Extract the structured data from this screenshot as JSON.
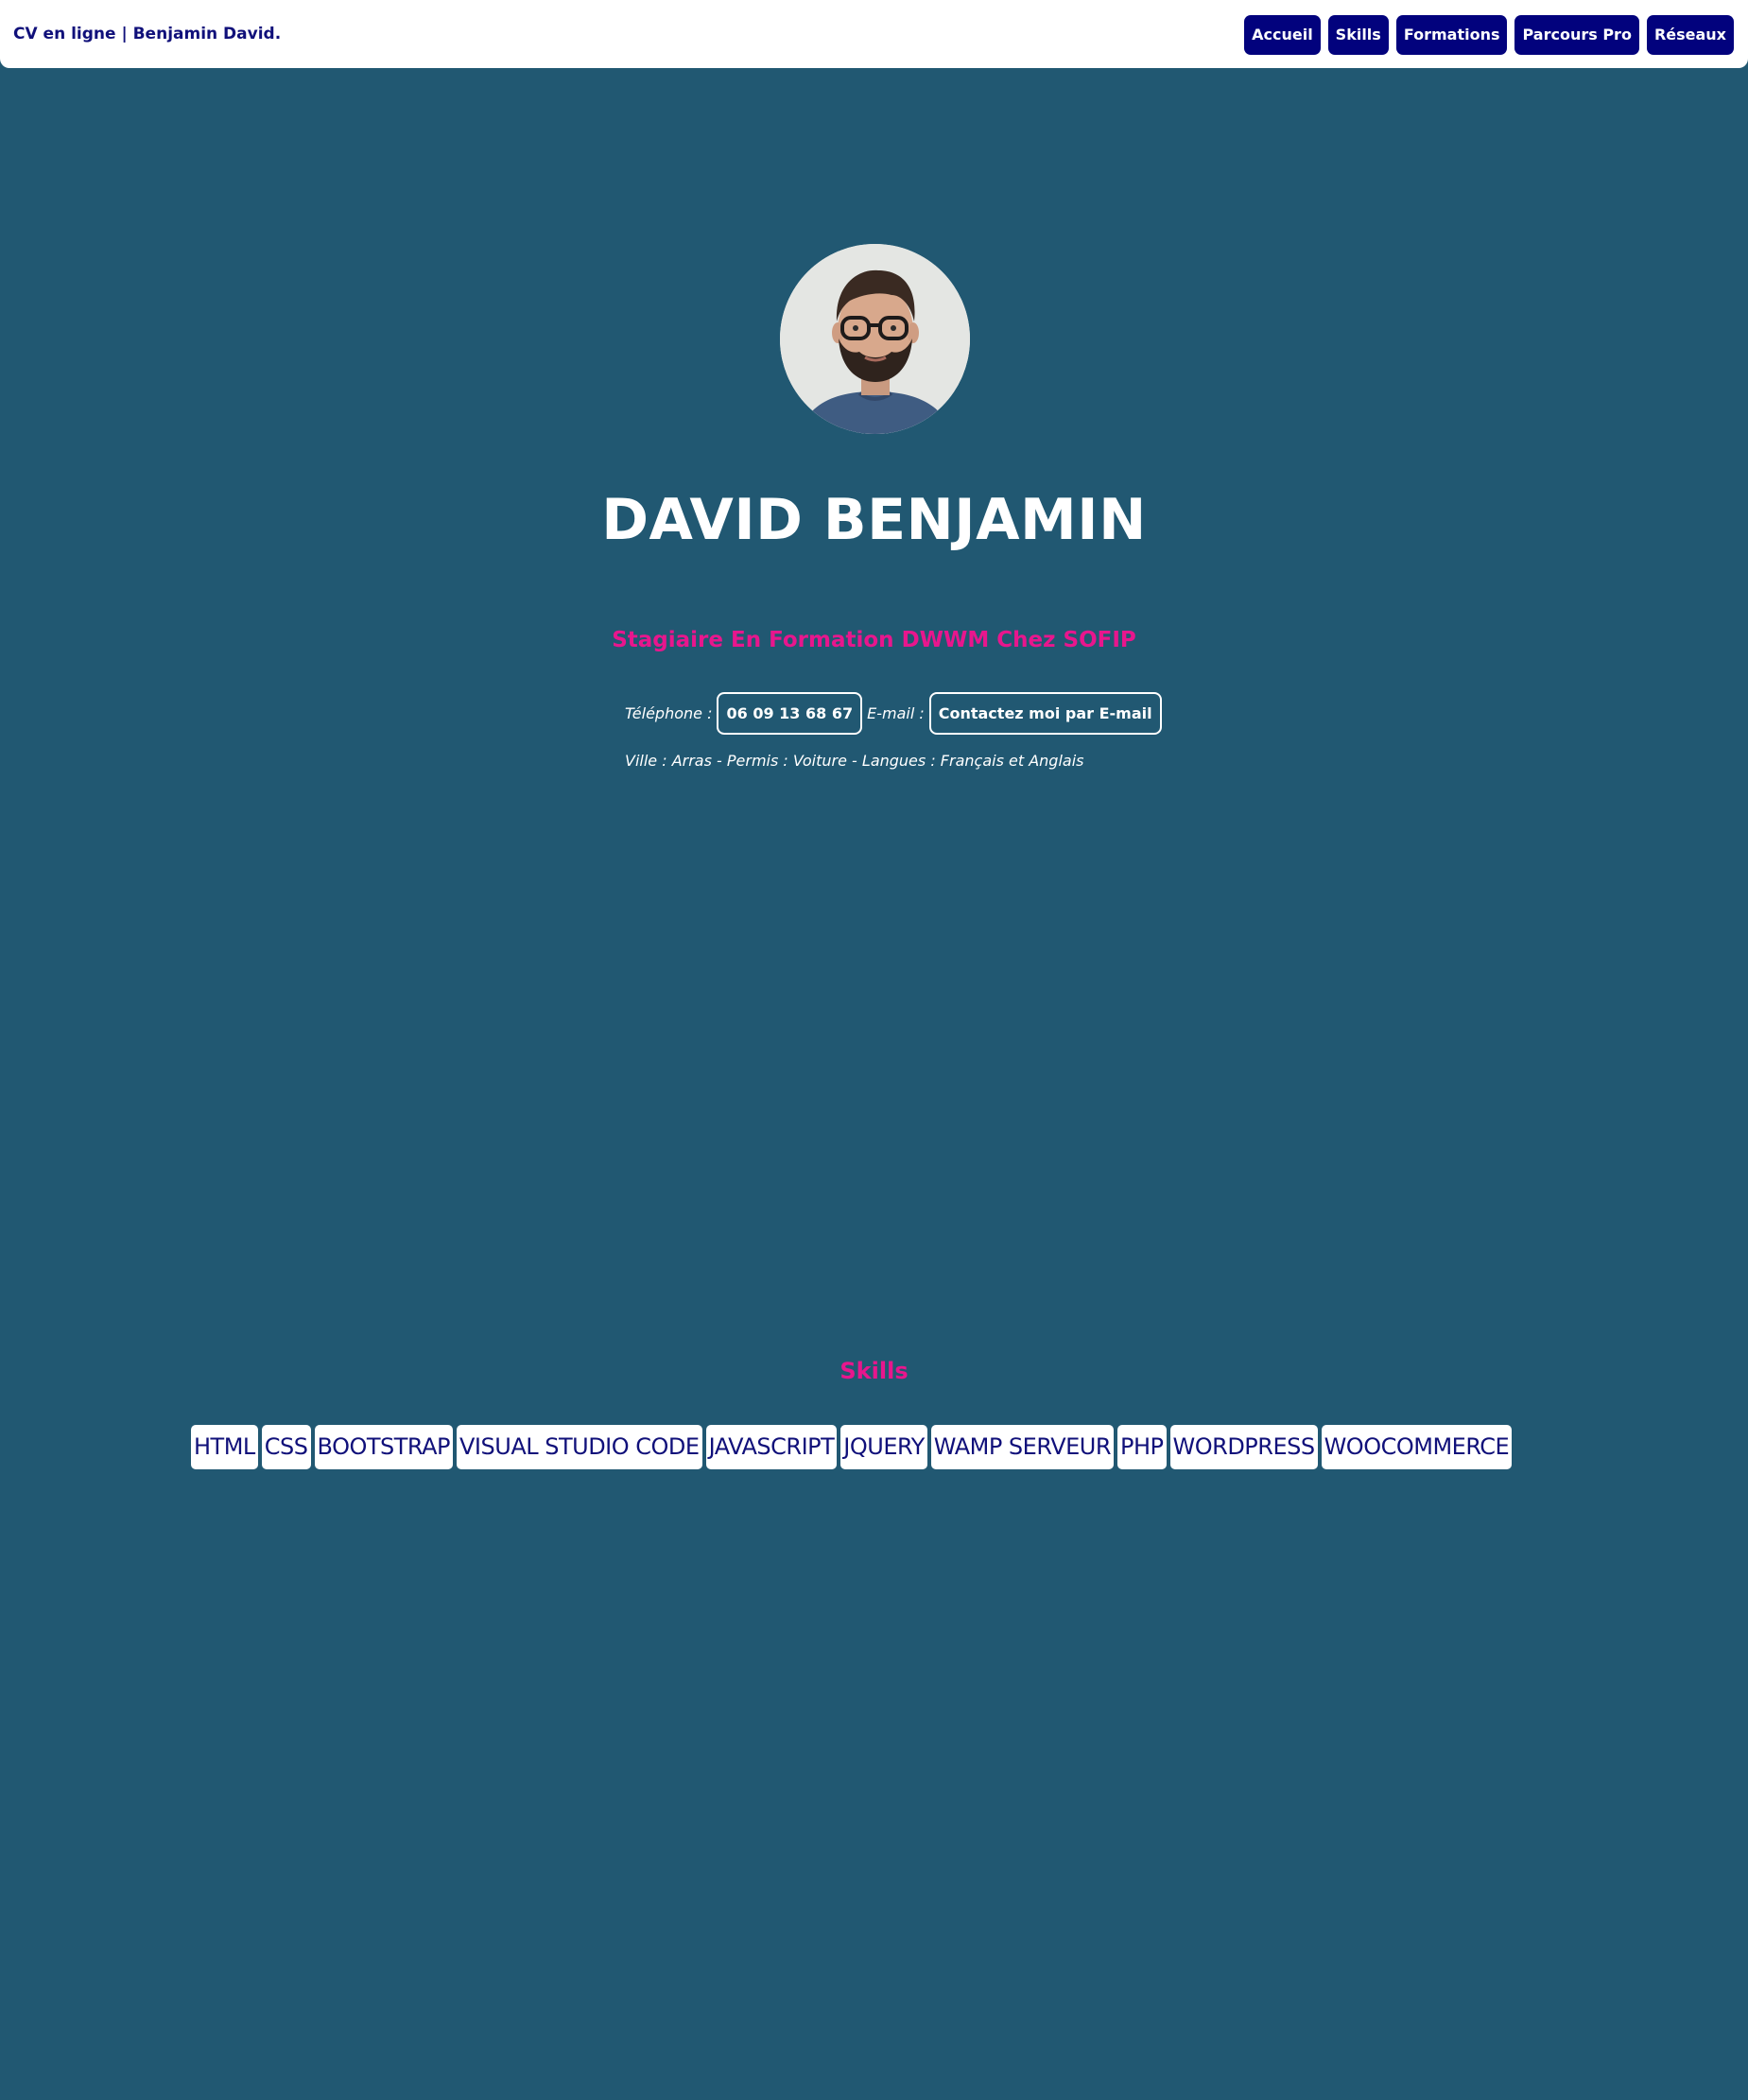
{
  "header": {
    "brand": "CV en ligne | Benjamin David.",
    "nav": [
      "Accueil",
      "Skills",
      "Formations",
      "Parcours Pro",
      "Réseaux"
    ]
  },
  "hero": {
    "name": "DAVID BENJAMIN",
    "subtitle": "Stagiaire En Formation DWWM Chez SOFIP",
    "phone_label": "Téléphone :",
    "phone_value": "06 09 13 68 67",
    "email_label": "E-mail :",
    "email_button": "Contactez moi par E-mail",
    "info": "Ville : Arras - Permis : Voiture - Langues : Français et Anglais"
  },
  "skills": {
    "title": "Skills",
    "items": [
      "HTML",
      "CSS",
      "BOOTSTRAP",
      "VISUAL STUDIO CODE",
      "JAVASCRIPT",
      "JQUERY",
      "WAMP SERVEUR",
      "PHP",
      "WORDPRESS",
      "WOOCOMMERCE"
    ]
  },
  "colors": {
    "background": "#215872",
    "navy": "#02027d",
    "accent_pink": "#e8168d",
    "white": "#ffffff"
  }
}
